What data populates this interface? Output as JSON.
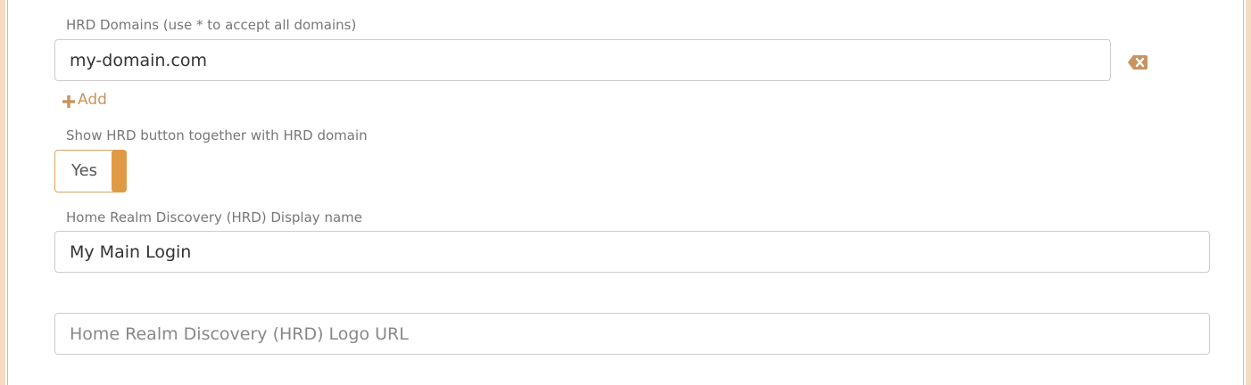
{
  "hrd_domains": {
    "label": "HRD Domains (use * to accept all domains)",
    "value": "my-domain.com",
    "add_label": "Add"
  },
  "show_hrd_button": {
    "label": "Show HRD button together with HRD domain",
    "value": "Yes"
  },
  "display_name": {
    "label": "Home Realm Discovery (HRD) Display name",
    "value": "My Main Login"
  },
  "logo_url": {
    "placeholder": "Home Realm Discovery (HRD) Logo URL",
    "value": ""
  },
  "icons": {
    "remove": "backspace-icon",
    "add": "plus-icon"
  },
  "colors": {
    "accent": "#e09a45",
    "link": "#c8935e",
    "panel_border": "#f3dcc0"
  }
}
